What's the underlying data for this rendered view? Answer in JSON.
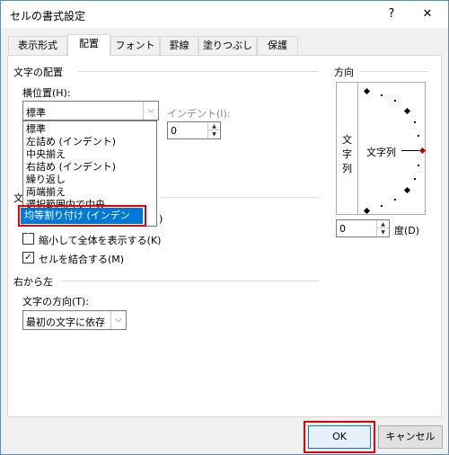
{
  "window": {
    "title": "セルの書式設定",
    "help_label": "?",
    "close_label": "✕"
  },
  "tabs": [
    {
      "label": "表示形式"
    },
    {
      "label": "配置"
    },
    {
      "label": "フォント"
    },
    {
      "label": "罫線"
    },
    {
      "label": "塗りつぶし"
    },
    {
      "label": "保護"
    }
  ],
  "text_alignment": {
    "group_title": "文字の配置",
    "horizontal_label": "横位置(H):",
    "horizontal_value": "標準",
    "indent_label": "インデント(I):",
    "indent_value": "0",
    "dropdown_options": [
      "標準",
      "左詰め (インデント)",
      "中央揃え",
      "右詰め (インデント)",
      "繰り返し",
      "両端揃え",
      "選択範囲内で中央",
      "均等割り付け (インデント)"
    ],
    "selected_option": "均等割り付け (インデント)"
  },
  "text_control": {
    "group_title_fragment": "文",
    "hidden_fragment": ")",
    "shrink_label": "縮小して全体を表示する(K)",
    "merge_label": "セルを結合する(M)",
    "merge_checked": true,
    "shrink_checked": false
  },
  "rtl": {
    "group_title": "右から左",
    "direction_label": "文字の方向(T):",
    "direction_value": "最初の文字に依存"
  },
  "orientation": {
    "group_title": "方向",
    "vertical_text": [
      "文",
      "字",
      "列"
    ],
    "horizontal_text": "文字列",
    "degree_value": "0",
    "degree_label": "度(D)"
  },
  "buttons": {
    "ok": "OK",
    "cancel": "キャンセル"
  }
}
